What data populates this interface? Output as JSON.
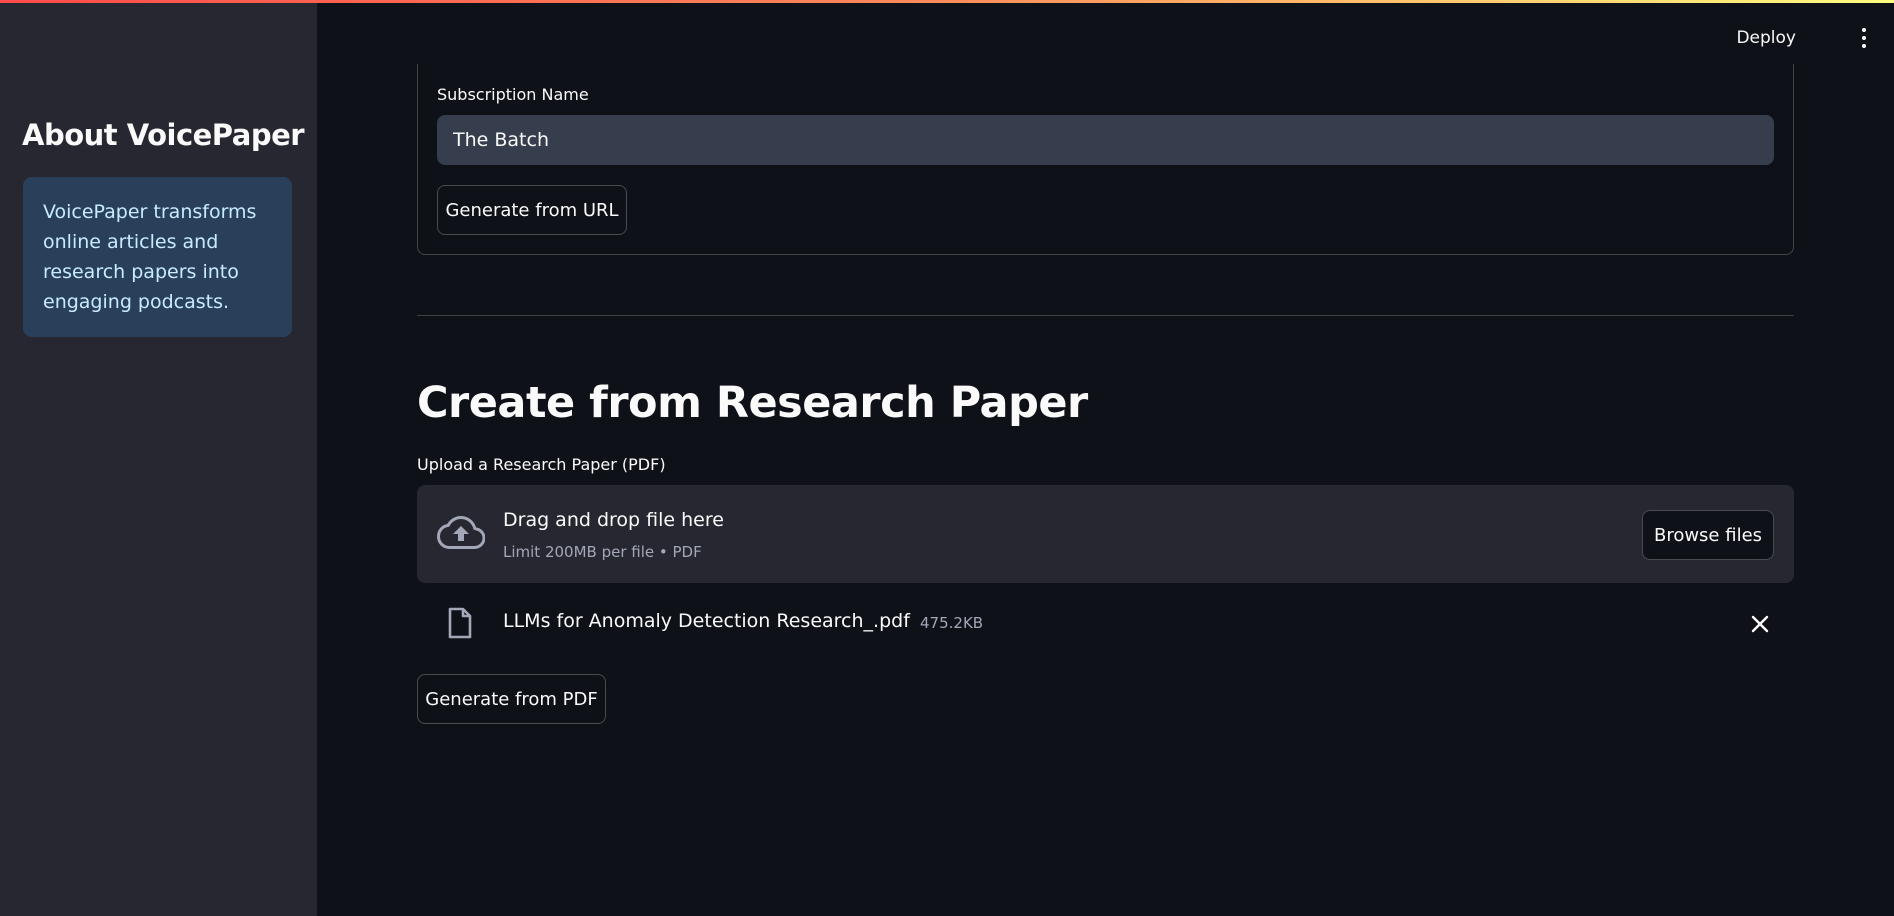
{
  "sidebar": {
    "title": "About VoicePaper",
    "info": "VoicePaper transforms online articles and research papers into engaging podcasts."
  },
  "header": {
    "deploy_label": "Deploy",
    "menu_icon": "more-vertical-icon"
  },
  "url_form": {
    "subscription_label": "Subscription Name",
    "subscription_value": "The Batch",
    "generate_label": "Generate from URL"
  },
  "pdf_section": {
    "title": "Create from Research Paper",
    "upload_label": "Upload a Research Paper (PDF)",
    "dropzone_title": "Drag and drop file here",
    "dropzone_sub": "Limit 200MB per file • PDF",
    "browse_label": "Browse files",
    "file": {
      "name": "LLMs for Anomaly Detection Research_.pdf",
      "size": "475.2KB"
    },
    "generate_label": "Generate from PDF"
  },
  "colors": {
    "background": "#0e1117",
    "sidebar": "#262730",
    "info_box": "#2a3f5a",
    "accent_gradient_start": "#ff4b4b",
    "accent_gradient_end": "#fffd80"
  }
}
